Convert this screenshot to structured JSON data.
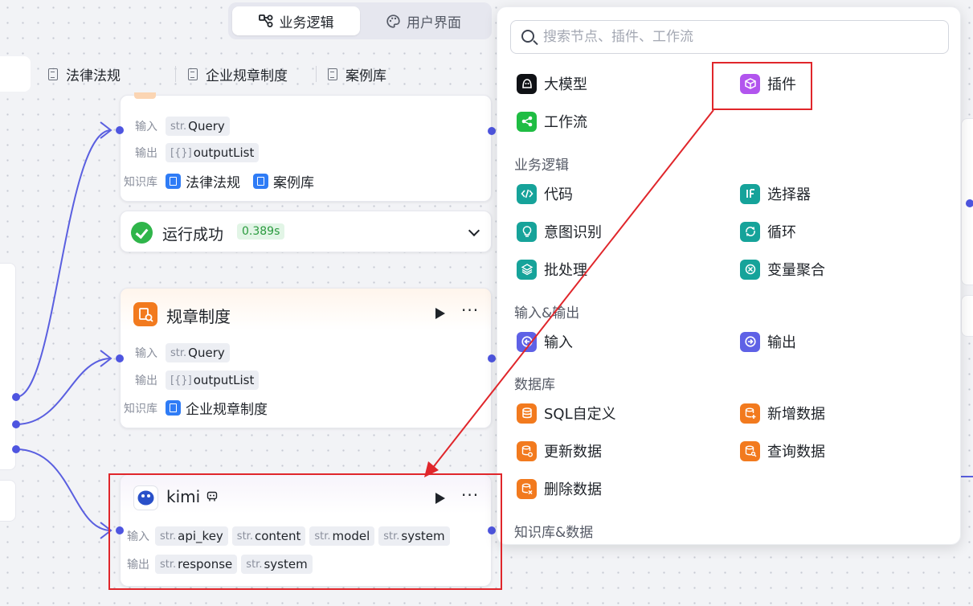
{
  "mode_tabs": [
    {
      "label": "业务逻辑",
      "icon": "flow-icon",
      "active": true
    },
    {
      "label": "用户界面",
      "icon": "palette-icon",
      "active": false
    }
  ],
  "kb_tabs": [
    "法律法规",
    "企业规章制度",
    "案例库"
  ],
  "node_top": {
    "input_label": "输入",
    "output_label": "输出",
    "kb_label": "知识库",
    "input_type": "str.",
    "input_value": "Query",
    "output_type": "[{}]",
    "output_value": "outputList",
    "kbs": [
      "法律法规",
      "案例库"
    ]
  },
  "run_status": {
    "label": "运行成功",
    "time": "0.389s"
  },
  "node_rules": {
    "title": "规章制度",
    "input_label": "输入",
    "output_label": "输出",
    "kb_label": "知识库",
    "input_type": "str.",
    "input_value": "Query",
    "output_type": "[{}]",
    "output_value": "outputList",
    "kbs": [
      "企业规章制度"
    ]
  },
  "node_kimi": {
    "title": "kimi",
    "input_label": "输入",
    "output_label": "输出",
    "inputs": [
      {
        "type": "str.",
        "name": "api_key"
      },
      {
        "type": "str.",
        "name": "content"
      },
      {
        "type": "str.",
        "name": "model"
      },
      {
        "type": "str.",
        "name": "system"
      }
    ],
    "outputs": [
      {
        "type": "str.",
        "name": "response"
      },
      {
        "type": "str.",
        "name": "system"
      }
    ]
  },
  "panel": {
    "search_placeholder": "搜索节点、插件、工作流",
    "top_items": [
      {
        "label": "大模型",
        "icon": "llm-icon",
        "color": "#0f1115"
      },
      {
        "label": "插件",
        "icon": "plugin-cube-icon",
        "color": "#b255ee"
      },
      {
        "label": "工作流",
        "icon": "workflow-icon",
        "color": "#1fbd43"
      }
    ],
    "sections": [
      {
        "title": "业务逻辑",
        "items": [
          {
            "label": "代码",
            "icon": "code-icon"
          },
          {
            "label": "选择器",
            "icon": "if-icon"
          },
          {
            "label": "意图识别",
            "icon": "bulb-icon"
          },
          {
            "label": "循环",
            "icon": "loop-icon"
          },
          {
            "label": "批处理",
            "icon": "layers-icon"
          },
          {
            "label": "变量聚合",
            "icon": "merge-icon"
          }
        ]
      },
      {
        "title": "输入&输出",
        "items": [
          {
            "label": "输入",
            "icon": "input-icon"
          },
          {
            "label": "输出",
            "icon": "output-icon"
          }
        ]
      },
      {
        "title": "数据库",
        "items": [
          {
            "label": "SQL自定义",
            "icon": "database-icon"
          },
          {
            "label": "新增数据",
            "icon": "db-add-icon"
          },
          {
            "label": "更新数据",
            "icon": "db-update-icon"
          },
          {
            "label": "查询数据",
            "icon": "db-query-icon"
          },
          {
            "label": "删除数据",
            "icon": "db-delete-icon"
          }
        ]
      },
      {
        "title": "知识库&数据",
        "items": []
      }
    ]
  },
  "colors": {
    "port": "#4e55e0",
    "annotation_red": "#e0262b",
    "success_green": "#2fb54a"
  }
}
